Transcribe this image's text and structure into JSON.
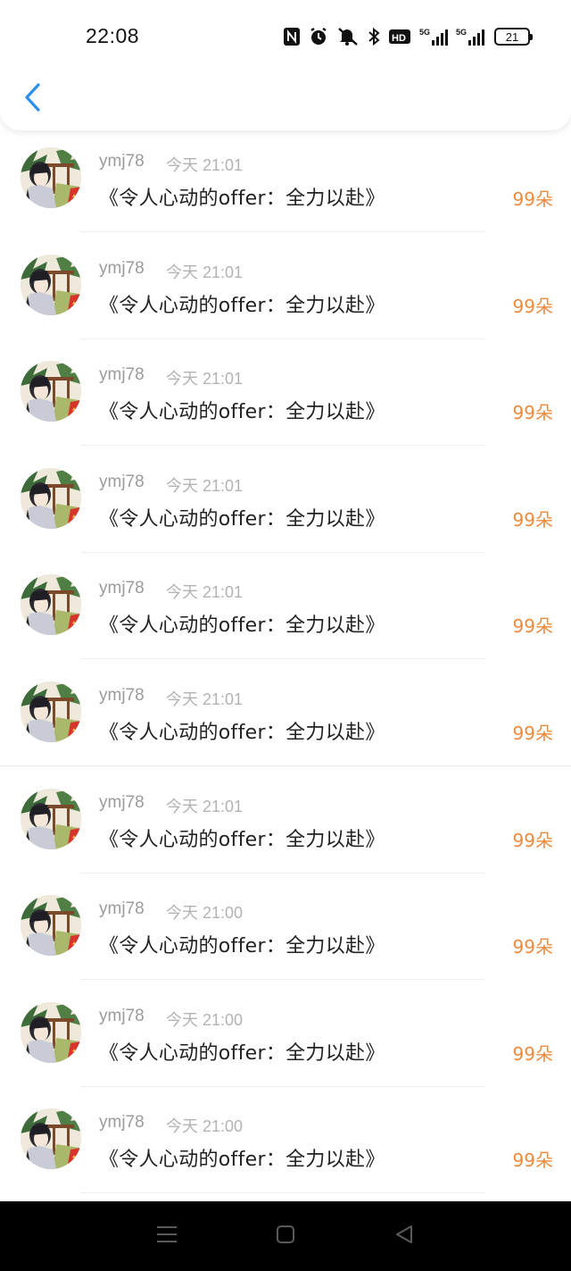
{
  "status_bar": {
    "time": "22:08",
    "icons": [
      "nfc-icon",
      "alarm-icon",
      "mute-icon",
      "bluetooth-icon",
      "hd-icon",
      "5g-signal-icon",
      "5g-signal-icon"
    ],
    "battery_level": "21"
  },
  "header": {
    "back_icon": "chevron-left-icon",
    "accent_color": "#2b8ff0"
  },
  "gifts": [
    {
      "name": "ymj78",
      "time": "今天 21:01",
      "title": "《令人心动的offer：全力以赴》",
      "count": "99朵"
    },
    {
      "name": "ymj78",
      "time": "今天 21:01",
      "title": "《令人心动的offer：全力以赴》",
      "count": "99朵"
    },
    {
      "name": "ymj78",
      "time": "今天 21:01",
      "title": "《令人心动的offer：全力以赴》",
      "count": "99朵"
    },
    {
      "name": "ymj78",
      "time": "今天 21:01",
      "title": "《令人心动的offer：全力以赴》",
      "count": "99朵"
    },
    {
      "name": "ymj78",
      "time": "今天 21:01",
      "title": "《令人心动的offer：全力以赴》",
      "count": "99朵"
    },
    {
      "name": "ymj78",
      "time": "今天 21:01",
      "title": "《令人心动的offer：全力以赴》",
      "count": "99朵"
    },
    {
      "name": "ymj78",
      "time": "今天 21:01",
      "title": "《令人心动的offer：全力以赴》",
      "count": "99朵"
    },
    {
      "name": "ymj78",
      "time": "今天 21:00",
      "title": "《令人心动的offer：全力以赴》",
      "count": "99朵"
    },
    {
      "name": "ymj78",
      "time": "今天 21:00",
      "title": "《令人心动的offer：全力以赴》",
      "count": "99朵"
    },
    {
      "name": "ymj78",
      "time": "今天 21:00",
      "title": "《令人心动的offer：全力以赴》",
      "count": "99朵"
    }
  ],
  "count_color": "#ee8a3c",
  "nav_bar": {
    "icons": [
      "menu-icon",
      "home-icon",
      "back-triangle-icon"
    ]
  }
}
